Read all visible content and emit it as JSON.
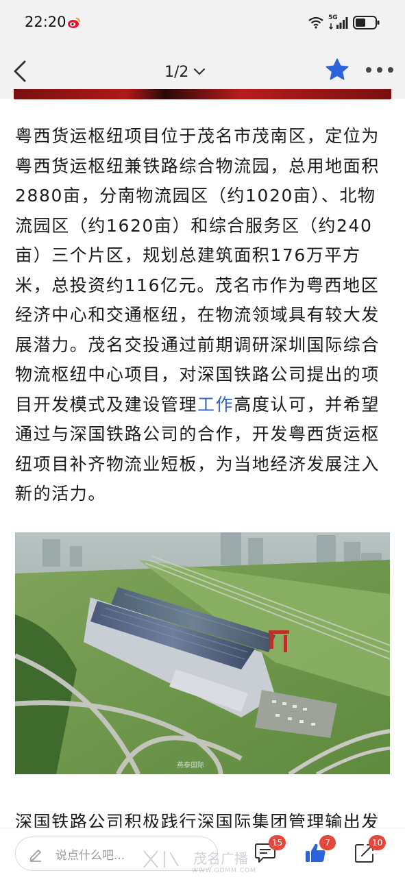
{
  "status_bar": {
    "time": "22:20",
    "network": "5G",
    "icons": [
      "weibo-icon",
      "wifi-icon",
      "signal-icon",
      "battery-icon"
    ]
  },
  "nav": {
    "page_indicator": "1/2",
    "icons": [
      "back-arrow-icon",
      "chevron-down-icon",
      "star-icon",
      "more-dots-icon"
    ],
    "star_color": "#2c63d8"
  },
  "article": {
    "paragraph_1_before_link": "粤西货运枢纽项目位于茂名市茂南区，定位为粤西货运枢纽兼铁路综合物流园，总用地面积2880亩，分南物流园区（约1020亩）、北物流园区（约1620亩）和综合服务区（约240亩）三个片区，规划总建筑面积176万平方米，总投资约116亿元。茂名市作为粤西地区经济中心和交通枢纽，在物流领域具有较大发展潜力。茂名交投通过前期调研深圳国际综合物流枢纽中心项目，对深国铁路公司提出的项目开发模式及建设管理",
    "paragraph_1_link": "工作",
    "paragraph_1_after_link": "高度认可，并希望通过与深国铁路公司的合作，开发粤西货运枢纽项目补齐物流业短板，为当地经济发展注入新的活力。",
    "image_watermark": "燕泰国际",
    "paragraph_2": "深国铁路公司积极践行深国际集团管理输出发"
  },
  "bottom_bar": {
    "comment_placeholder": "说点什么吧...",
    "comment_count": "15",
    "like_count": "7",
    "share_count": "10",
    "like_color": "#2c63d8",
    "badge_color": "#e4483c"
  },
  "watermark": {
    "text": "茂名广播",
    "url": "WWW.GDMM.COM"
  }
}
